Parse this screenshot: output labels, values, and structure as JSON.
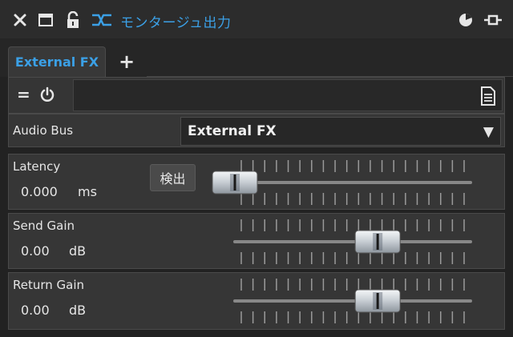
{
  "window": {
    "title": "モンタージュ出力",
    "accent_color": "#3ba0e6"
  },
  "icons": {
    "close": "close-icon",
    "maximize": "window-icon",
    "lock": "unlock-icon",
    "routing": "routing-icon",
    "pie": "pie-icon",
    "pin": "pin-icon",
    "power": "power-icon",
    "document": "document-icon"
  },
  "tabs": [
    {
      "label": "External FX",
      "active": true
    }
  ],
  "tab_add_label": "+",
  "toolbar": {
    "equal_label": "="
  },
  "audio_bus": {
    "label": "Audio Bus",
    "value": "External FX",
    "arrow": "▼"
  },
  "latency": {
    "label": "Latency",
    "value": "0.000",
    "unit": "ms",
    "detect_button": "検出",
    "level": 0.0
  },
  "send_gain": {
    "label": "Send Gain",
    "value": "0.00",
    "unit": "dB",
    "level": 0.68
  },
  "return_gain": {
    "label": "Return Gain",
    "value": "0.00",
    "unit": "dB",
    "level": 0.68
  }
}
